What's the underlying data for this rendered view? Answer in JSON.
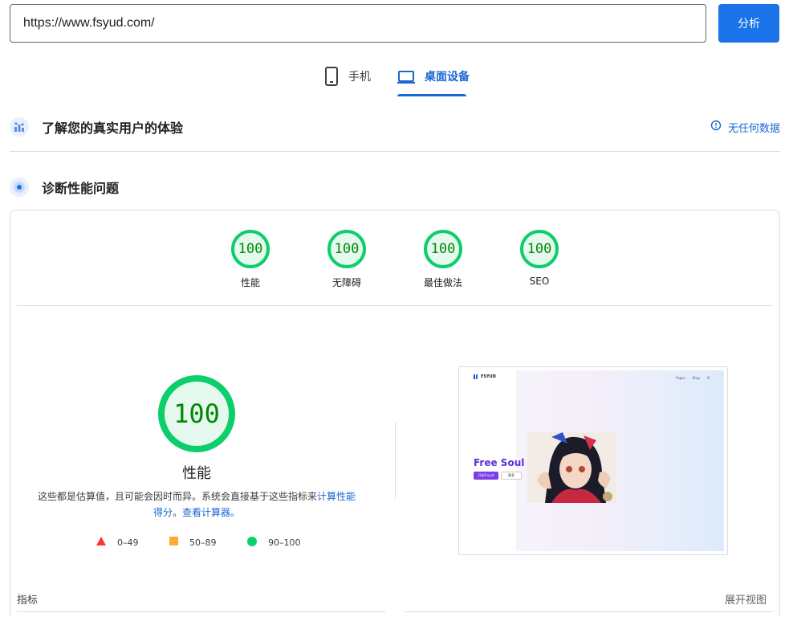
{
  "url_bar": {
    "value": "https://www.fsyud.com/",
    "analyze_label": "分析"
  },
  "tabs": [
    {
      "label": "手机",
      "icon": "phone-icon",
      "selected": false
    },
    {
      "label": "桌面设备",
      "icon": "laptop-icon",
      "selected": true
    }
  ],
  "field_data": {
    "title": "了解您的真实用户的体验",
    "no_data_label": "无任何数据",
    "icon": "users-chart-icon"
  },
  "diagnose": {
    "title": "诊断性能问题",
    "icon": "lighthouse-icon"
  },
  "scores": [
    {
      "label": "性能",
      "value": "100"
    },
    {
      "label": "无障碍",
      "value": "100"
    },
    {
      "label": "最佳做法",
      "value": "100"
    },
    {
      "label": "SEO",
      "value": "100"
    }
  ],
  "performance": {
    "score": "100",
    "title": "性能",
    "desc_text": "这些都是估算值，且可能会因时而异。系统会直接基于这些指标来",
    "desc_link1": "计算性能得分",
    "desc_sep": "。",
    "desc_link2": "查看计算器。"
  },
  "legend": [
    {
      "range": "0–49",
      "shape": "triangle",
      "color": "#ff3333"
    },
    {
      "range": "50–89",
      "shape": "square",
      "color": "#ffaa33"
    },
    {
      "range": "90–100",
      "shape": "circle",
      "color": "#0cce6b"
    }
  ],
  "thumbnail": {
    "brand": "FSYUD",
    "nav": [
      "Pages",
      "Blog",
      "Ⅵ"
    ],
    "hero": "Free Soul",
    "btn1": "开始Fsyud",
    "btn2": "更多"
  },
  "metrics": {
    "label": "指标",
    "expand_label": "展开视图"
  },
  "colors": {
    "accent": "#1a73e8",
    "pass": "#0cce6b",
    "pass_text": "#008800"
  }
}
